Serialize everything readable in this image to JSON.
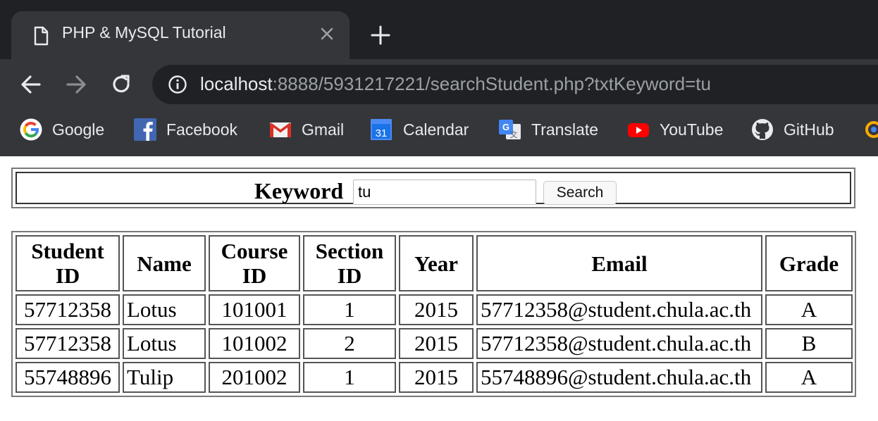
{
  "browser": {
    "tab": {
      "title": "PHP & MySQL Tutorial",
      "icon": "document-icon"
    },
    "address": {
      "host": "localhost",
      "rest": ":8888/5931217221/searchStudent.php?txtKeyword=tu"
    },
    "bookmarks": [
      {
        "label": "Google",
        "icon": "google-icon"
      },
      {
        "label": "Facebook",
        "icon": "facebook-icon"
      },
      {
        "label": "Gmail",
        "icon": "gmail-icon"
      },
      {
        "label": "Calendar",
        "icon": "calendar-icon",
        "icon_text": "31"
      },
      {
        "label": "Translate",
        "icon": "translate-icon"
      },
      {
        "label": "YouTube",
        "icon": "youtube-icon"
      },
      {
        "label": "GitHub",
        "icon": "github-icon"
      }
    ]
  },
  "search": {
    "label": "Keyword",
    "value": "tu",
    "button": "Search"
  },
  "table": {
    "headers": [
      "Student ID",
      "Name",
      "Course ID",
      "Section ID",
      "Year",
      "Email",
      "Grade"
    ],
    "rows": [
      [
        "57712358",
        "Lotus",
        "101001",
        "1",
        "2015",
        "57712358@student.chula.ac.th",
        "A"
      ],
      [
        "57712358",
        "Lotus",
        "101002",
        "2",
        "2015",
        "57712358@student.chula.ac.th",
        "B"
      ],
      [
        "55748896",
        "Tulip",
        "201002",
        "1",
        "2015",
        "55748896@student.chula.ac.th",
        "A"
      ]
    ]
  },
  "colors": {
    "chrome": "#35363a",
    "tabstrip": "#202124",
    "text": "#e8eaed",
    "dim": "#9aa0a6"
  }
}
